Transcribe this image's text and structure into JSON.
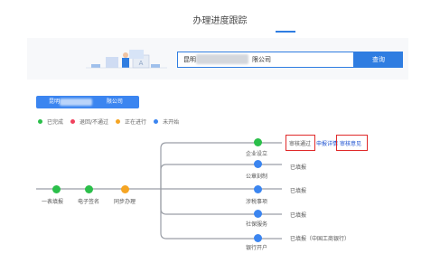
{
  "header": {
    "title": "办理进度跟踪"
  },
  "search": {
    "company_prefix": "昆明",
    "company_suffix": "限公司",
    "button_label": "查询"
  },
  "company_tab": {
    "prefix": "昆明",
    "suffix": "限公司"
  },
  "legend": [
    {
      "label": "已完成",
      "color": "#2bbf4a"
    },
    {
      "label": "退回/不通过",
      "color": "#f0425d"
    },
    {
      "label": "正在进行",
      "color": "#f5a524"
    },
    {
      "label": "未开始",
      "color": "#3b85f0"
    }
  ],
  "flow_main": [
    {
      "label": "一表填报",
      "status": "done"
    },
    {
      "label": "电子签名",
      "status": "done"
    },
    {
      "label": "同步办理",
      "status": "in_progress"
    }
  ],
  "flow_branches": [
    {
      "label": "企业设立",
      "status": "done"
    },
    {
      "label": "公章刻制",
      "status": "not_started"
    },
    {
      "label": "涉税事项",
      "status": "not_started"
    },
    {
      "label": "社保服务",
      "status": "not_started"
    },
    {
      "label": "银行开户",
      "status": "not_started"
    }
  ],
  "branch_status": {
    "enterprise": {
      "approved": "审核通过",
      "application_review": "申报详情",
      "review_opinion": "审核意见"
    },
    "seal": "已填报",
    "tax": "已填报",
    "social": "已填报",
    "bank": "已填报（中国工商银行）"
  },
  "colors": {
    "done": "#2bbf4a",
    "in_progress": "#f5a524",
    "not_started": "#3b85f0",
    "accent": "#2f7de1"
  }
}
